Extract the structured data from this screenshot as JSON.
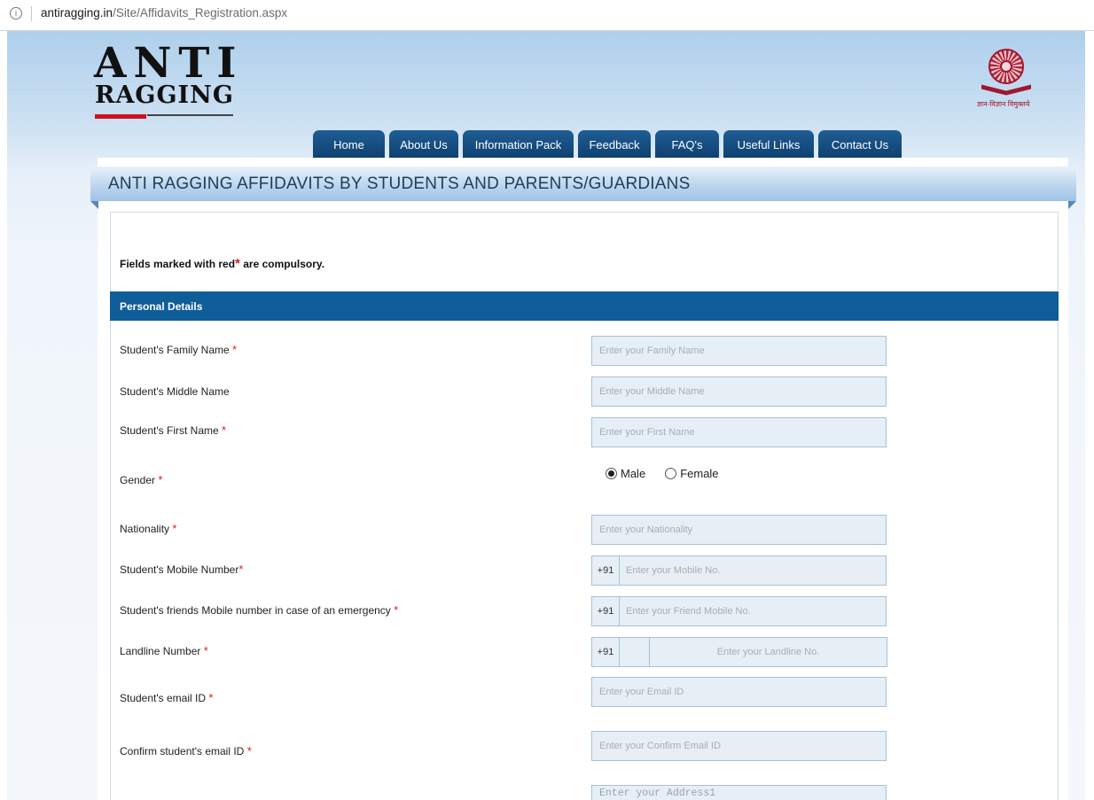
{
  "browser": {
    "url_domain": "antiragging.in",
    "url_path": "/Site/Affidavits_Registration.aspx"
  },
  "logo": {
    "line1": "ANTI",
    "line2": "RAGGING"
  },
  "emblem": {
    "caption": "ज्ञान-विज्ञान विमुक्तये"
  },
  "nav": {
    "tabs": [
      "Home",
      "About Us",
      "Information Pack",
      "Feedback",
      "FAQ's",
      "Useful Links",
      "Contact Us"
    ]
  },
  "page": {
    "title": "ANTI RAGGING AFFIDAVITS BY STUDENTS AND PARENTS/GUARDIANS",
    "note_prefix": "Fields marked with red",
    "note_star": "*",
    "note_suffix": " are compulsory."
  },
  "section": {
    "title": "Personal Details"
  },
  "form": {
    "family_name": {
      "label": "Student's Family Name",
      "req": "*",
      "placeholder": "Enter your Family Name"
    },
    "middle_name": {
      "label": "Student's Middle Name",
      "placeholder": "Enter your Middle Name"
    },
    "first_name": {
      "label": "Student's First Name",
      "req": "*",
      "placeholder": "Enter your First Name"
    },
    "gender": {
      "label": "Gender",
      "req": "*",
      "options": [
        "Male",
        "Female"
      ],
      "selected": "Male"
    },
    "nationality": {
      "label": "Nationality",
      "req": "*",
      "placeholder": "Enter your Nationality"
    },
    "mobile": {
      "label": "Student's Mobile Number",
      "req": "*",
      "prefix": "+91",
      "placeholder": "Enter your Mobile No."
    },
    "friend_mobile": {
      "label": "Student's friends Mobile number in case of an emergency",
      "req": "*",
      "prefix": "+91",
      "placeholder": "Enter your Friend Mobile No."
    },
    "landline": {
      "label": "Landline Number",
      "req": "*",
      "prefix": "+91",
      "placeholder": "Enter your Landline No."
    },
    "email": {
      "label": "Student's email ID",
      "req": "*",
      "placeholder": "Enter your Email ID"
    },
    "confirm_email": {
      "label": "Confirm student's email ID",
      "req": "*",
      "placeholder": "Enter your Confirm Email ID"
    },
    "address1": {
      "placeholder": "Enter your Address1"
    }
  }
}
